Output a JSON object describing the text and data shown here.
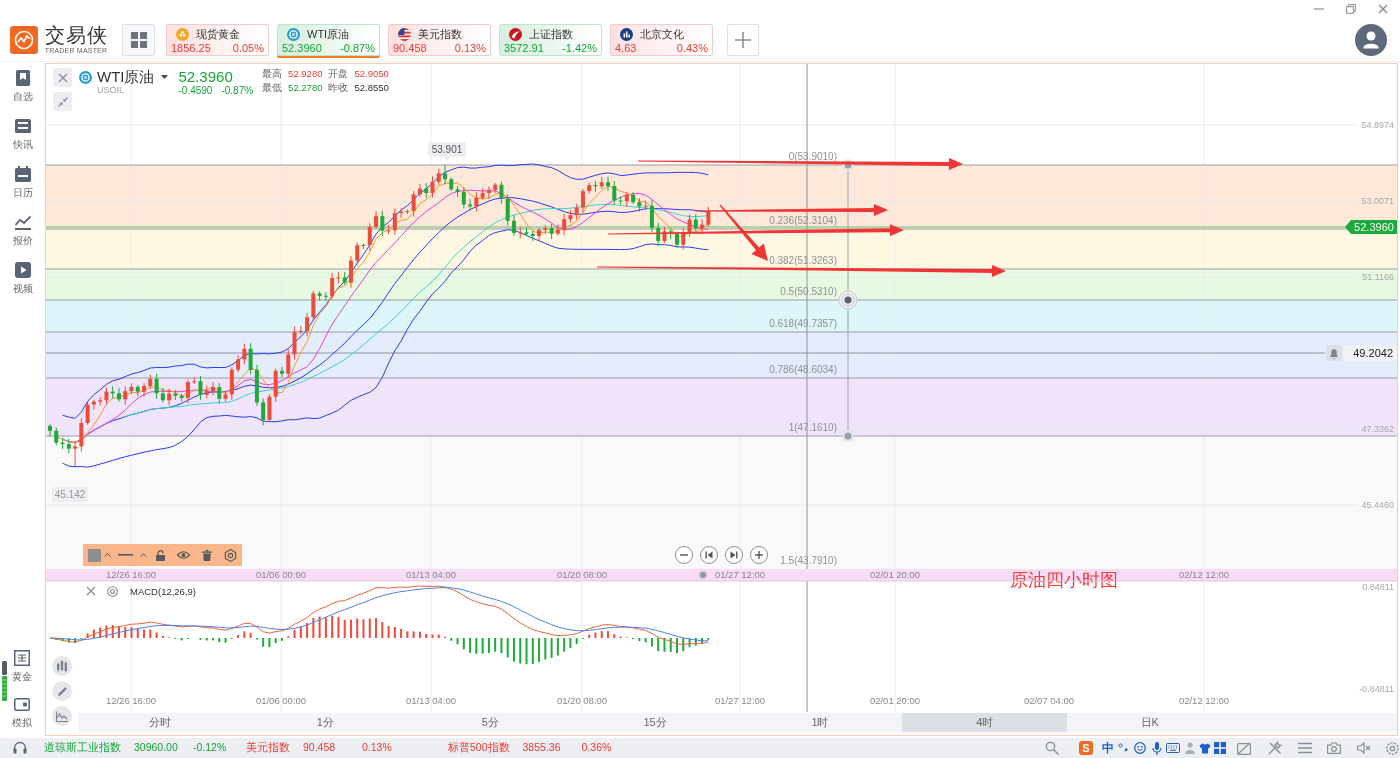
{
  "header": {
    "logo": {
      "title": "交易侠",
      "subtitle": "TRADER MASTER"
    },
    "quote_cards": [
      {
        "kind": "gold",
        "name": "现货黄金",
        "price": "1856.25",
        "change": "0.05%",
        "rising": true,
        "selected": false
      },
      {
        "kind": "oil",
        "name": "WTI原油",
        "price": "52.3960",
        "change": "-0.87%",
        "rising": false,
        "selected": true
      },
      {
        "kind": "flag",
        "name": "美元指数",
        "price": "90.458",
        "change": "0.13%",
        "rising": true,
        "selected": false
      },
      {
        "kind": "exchange",
        "name": "上证指数",
        "price": "3572.91",
        "change": "-1.42%",
        "rising": false,
        "selected": false
      },
      {
        "kind": "stock",
        "name": "北京文化",
        "price": "4.63",
        "change": "0.43%",
        "rising": true,
        "selected": false
      }
    ]
  },
  "sidebar": {
    "top_items": [
      {
        "kind": "bookmark",
        "label": "自选"
      },
      {
        "kind": "news",
        "label": "快讯"
      },
      {
        "kind": "calendar",
        "label": "日历"
      },
      {
        "kind": "chart",
        "label": "报价"
      },
      {
        "kind": "video",
        "label": "视频"
      }
    ],
    "bottom_items": [
      {
        "kind": "gold",
        "label": "黄金"
      },
      {
        "kind": "wallet",
        "label": "模拟"
      }
    ]
  },
  "chart": {
    "symbol": {
      "name": "WTI原油",
      "code": "USOIL",
      "price": "52.3960",
      "change": "-0.4590",
      "change_percent": "-0.87%",
      "rising": false
    },
    "stats": [
      {
        "label": "最高",
        "value": "52.9280",
        "rising": true
      },
      {
        "label": "开盘",
        "value": "52.9050",
        "rising": true
      },
      {
        "label": "最低",
        "value": "52.2780",
        "rising": false
      },
      {
        "label": "昨收",
        "value": "52.8550"
      }
    ],
    "price_axis": [
      "54.8974",
      "53.0071",
      "51.1166",
      "47.3362",
      "45.4460"
    ],
    "last_price_tag": "52.3960",
    "crosshair_price": "49.2042",
    "high_label": "53.901",
    "low_label": "45.142",
    "fib_levels": [
      {
        "label": "0(53.9010)"
      },
      {
        "label": "0.236(52.3104)",
        "color": "#fde8da"
      },
      {
        "label": "0.382(51.3263)",
        "color": "#fef8e3"
      },
      {
        "label": "0.5(50.5310)",
        "color": "#e8f9e2"
      },
      {
        "label": "0.618(49.7357)",
        "color": "#ddf6f9"
      },
      {
        "label": "0.786(48.6034)",
        "color": "#e4ebfb"
      },
      {
        "label": "1(47.1610)",
        "color": "#f0e4fa"
      },
      {
        "label": "1.5(43.7910)",
        "color": "#f9f9fa"
      }
    ],
    "time_axis_upper": [
      "12/26 16:00",
      "01/06 00:00",
      "01/13 04:00",
      "01/20 08:00",
      "01/27 12:00",
      "02/01 20:00",
      "02/12 12:00"
    ],
    "annotation": "原油四小时图",
    "macd": {
      "title": "MACD(12,26,9)",
      "axis": [
        "0.84811",
        "-0.84811"
      ]
    },
    "time_axis_lower": [
      "12/26 16:00",
      "01/06 00:00",
      "01/13 04:00",
      "01/20 08:00",
      "01/27 12:00",
      "02/01 20:00",
      "02/07 04:00",
      "02/12 12:00"
    ]
  },
  "periods": [
    {
      "label": "分时",
      "selected": false
    },
    {
      "label": "1分",
      "selected": false
    },
    {
      "label": "5分",
      "selected": false
    },
    {
      "label": "15分",
      "selected": false
    },
    {
      "label": "1时",
      "selected": false
    },
    {
      "label": "4时",
      "selected": true
    },
    {
      "label": "日K",
      "selected": false
    }
  ],
  "status_bar": {
    "tickers": [
      {
        "name": "道琼斯工业指数",
        "value": "30960.00",
        "change": "-0.12%",
        "rising": false
      },
      {
        "name": "美元指数",
        "value": "90.458",
        "change": "0.13%",
        "rising": true
      },
      {
        "name": "标普500指数",
        "value": "3855.36",
        "change": "0.36%",
        "rising": true
      }
    ],
    "ime_logo": "S",
    "ime_mode": "中"
  }
}
